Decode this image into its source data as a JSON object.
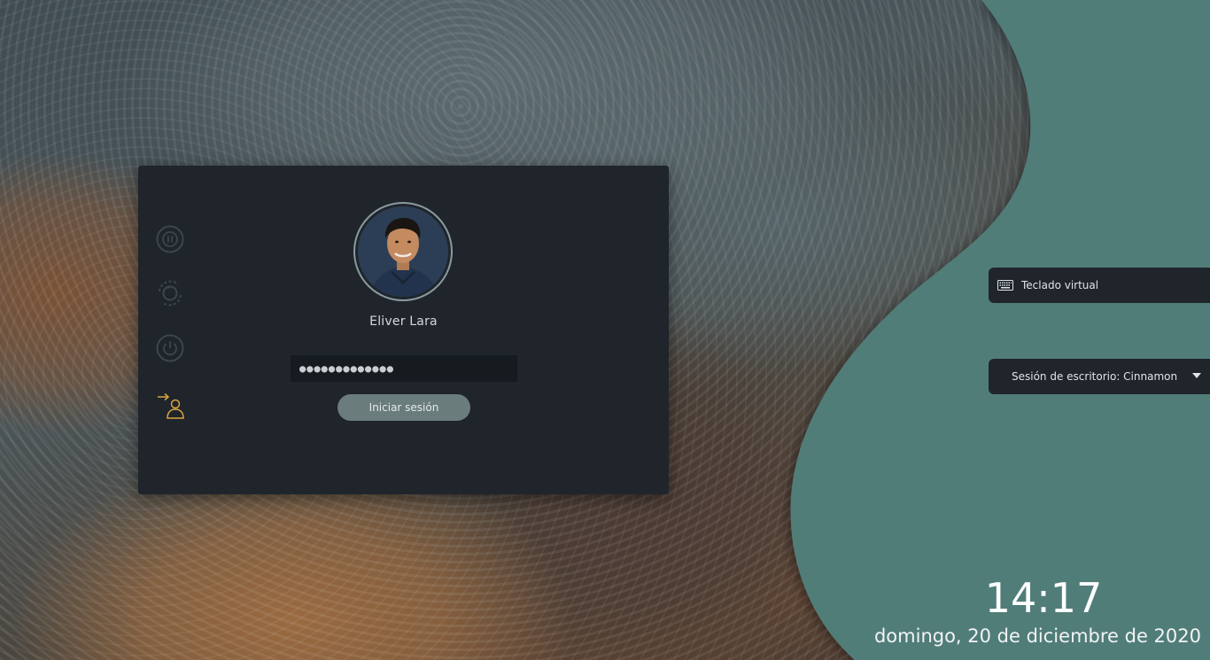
{
  "user": {
    "name": "Eliver Lara"
  },
  "password": {
    "masked_value": "●●●●●●●●●●●●●"
  },
  "login_button_label": "Iniciar sesión",
  "side_actions": [
    "suspend-icon",
    "restart-icon",
    "shutdown-icon",
    "switch-user-icon"
  ],
  "virtual_keyboard_label": "Teclado virtual",
  "session_label": "Sesión de escritorio: Cinnamon",
  "clock": {
    "time": "14:17",
    "date": "domingo, 20 de diciembre de 2020"
  },
  "colors": {
    "panel_teal": "#517d79",
    "card_bg": "#1f252b",
    "accent_orange": "#d9a441",
    "button_bg": "#6a7d7c"
  }
}
